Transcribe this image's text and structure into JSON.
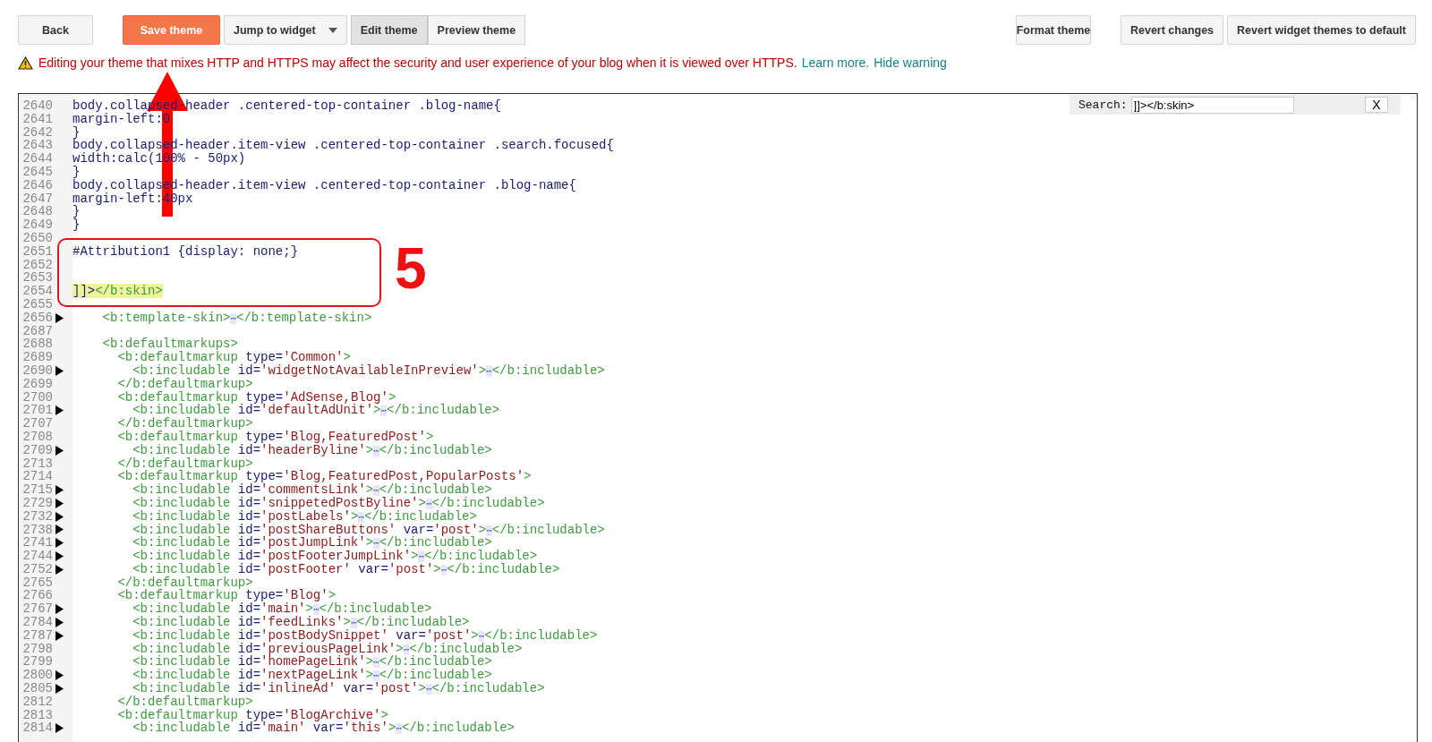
{
  "toolbar": {
    "left_buttons": [
      {
        "label": "Back",
        "kind": "plain"
      },
      {
        "label": "Save theme",
        "kind": "primary"
      },
      {
        "label": "Jump to widget",
        "kind": "dropdown"
      }
    ],
    "tabs": [
      {
        "label": "Edit theme",
        "selected": true
      },
      {
        "label": "Preview theme",
        "selected": false
      }
    ],
    "right_buttons": [
      {
        "label": "Format theme",
        "kind": "plain"
      },
      {
        "label": "Revert changes",
        "kind": "plain"
      },
      {
        "label": "Revert widget themes to default",
        "kind": "plain"
      }
    ]
  },
  "warning": {
    "text": "Editing your theme that mixes HTTP and HTTPS may affect the security and user experience of your blog when it is viewed over HTTPS.",
    "links": [
      "Learn more.",
      "Hide warning"
    ]
  },
  "editor": {
    "search": {
      "label": "Search:",
      "value": "]]></b:skin>",
      "close": "X"
    },
    "lines": [
      {
        "n": "2640",
        "fold": false,
        "t": [
          {
            "kind": "css",
            "text": "body.collapsed-header .centered-top-container .blog-name{"
          }
        ]
      },
      {
        "n": "2641",
        "fold": false,
        "t": [
          {
            "kind": "css",
            "text": "margin-left:0"
          }
        ]
      },
      {
        "n": "2642",
        "fold": false,
        "t": [
          {
            "kind": "css",
            "text": "}"
          }
        ]
      },
      {
        "n": "2643",
        "fold": false,
        "t": [
          {
            "kind": "css",
            "text": "body.collapsed-header.item-view .centered-top-container .search.focused{"
          }
        ]
      },
      {
        "n": "2644",
        "fold": false,
        "t": [
          {
            "kind": "css",
            "text": "width:calc(100% - 50px)"
          }
        ]
      },
      {
        "n": "2645",
        "fold": false,
        "t": [
          {
            "kind": "css",
            "text": "}"
          }
        ]
      },
      {
        "n": "2646",
        "fold": false,
        "t": [
          {
            "kind": "css",
            "text": "body.collapsed-header.item-view .centered-top-container .blog-name{"
          }
        ]
      },
      {
        "n": "2647",
        "fold": false,
        "t": [
          {
            "kind": "css",
            "text": "margin-left:40px"
          }
        ]
      },
      {
        "n": "2648",
        "fold": false,
        "t": [
          {
            "kind": "css",
            "text": "}"
          }
        ]
      },
      {
        "n": "2649",
        "fold": false,
        "t": [
          {
            "kind": "css",
            "text": "}"
          }
        ]
      },
      {
        "n": "2650",
        "fold": false
      },
      {
        "n": "2651",
        "fold": false,
        "t": [
          {
            "kind": "css",
            "text": "#Attribution1 {display: none;}"
          }
        ]
      },
      {
        "n": "2652",
        "fold": false
      },
      {
        "n": "2653",
        "fold": false
      },
      {
        "n": "2654",
        "fold": false,
        "t": [
          {
            "kind": "match-css",
            "text": "]]>"
          },
          {
            "kind": "match-tag",
            "text": "</b:skin>"
          }
        ]
      },
      {
        "n": "2655",
        "fold": false
      },
      {
        "n": "2656",
        "fold": true,
        "t": [
          {
            "kind": "tag",
            "text": "    <b:template-skin>"
          },
          {
            "kind": "ellipsis",
            "text": "⋯"
          },
          {
            "kind": "tag",
            "text": "</b:template-skin>"
          }
        ]
      },
      {
        "n": "2687",
        "fold": false
      },
      {
        "n": "2688",
        "fold": false,
        "t": [
          {
            "kind": "tag",
            "text": "    <b:defaultmarkups>"
          }
        ]
      },
      {
        "n": "2689",
        "fold": false,
        "t": [
          {
            "kind": "tag",
            "text": "      <b:defaultmarkup"
          },
          {
            "kind": "attr",
            "text": " type="
          },
          {
            "kind": "value",
            "text": "'Common'"
          },
          {
            "kind": "tag",
            "text": ">"
          }
        ]
      },
      {
        "n": "2690",
        "fold": true,
        "t": [
          {
            "kind": "tag",
            "text": "        <b:includable"
          },
          {
            "kind": "attr",
            "text": " id="
          },
          {
            "kind": "value",
            "text": "'widgetNotAvailableInPreview'"
          },
          {
            "kind": "tag",
            "text": ">"
          },
          {
            "kind": "ellipsis",
            "text": "⋯"
          },
          {
            "kind": "tag",
            "text": "</b:includable>"
          }
        ]
      },
      {
        "n": "2699",
        "fold": false,
        "t": [
          {
            "kind": "tag",
            "text": "      </b:defaultmarkup>"
          }
        ]
      },
      {
        "n": "2700",
        "fold": false,
        "t": [
          {
            "kind": "tag",
            "text": "      <b:defaultmarkup"
          },
          {
            "kind": "attr",
            "text": " type="
          },
          {
            "kind": "value",
            "text": "'AdSense,Blog'"
          },
          {
            "kind": "tag",
            "text": ">"
          }
        ]
      },
      {
        "n": "2701",
        "fold": true,
        "t": [
          {
            "kind": "tag",
            "text": "        <b:includable"
          },
          {
            "kind": "attr",
            "text": " id="
          },
          {
            "kind": "value",
            "text": "'defaultAdUnit'"
          },
          {
            "kind": "tag",
            "text": ">"
          },
          {
            "kind": "ellipsis",
            "text": "⋯"
          },
          {
            "kind": "tag",
            "text": "</b:includable>"
          }
        ]
      },
      {
        "n": "2707",
        "fold": false,
        "t": [
          {
            "kind": "tag",
            "text": "      </b:defaultmarkup>"
          }
        ]
      },
      {
        "n": "2708",
        "fold": false,
        "t": [
          {
            "kind": "tag",
            "text": "      <b:defaultmarkup"
          },
          {
            "kind": "attr",
            "text": " type="
          },
          {
            "kind": "value",
            "text": "'Blog,FeaturedPost'"
          },
          {
            "kind": "tag",
            "text": ">"
          }
        ]
      },
      {
        "n": "2709",
        "fold": true,
        "t": [
          {
            "kind": "tag",
            "text": "        <b:includable"
          },
          {
            "kind": "attr",
            "text": " id="
          },
          {
            "kind": "value",
            "text": "'headerByline'"
          },
          {
            "kind": "tag",
            "text": ">"
          },
          {
            "kind": "ellipsis",
            "text": "⋯"
          },
          {
            "kind": "tag",
            "text": "</b:includable>"
          }
        ]
      },
      {
        "n": "2713",
        "fold": false,
        "t": [
          {
            "kind": "tag",
            "text": "      </b:defaultmarkup>"
          }
        ]
      },
      {
        "n": "2714",
        "fold": false,
        "t": [
          {
            "kind": "tag",
            "text": "      <b:defaultmarkup"
          },
          {
            "kind": "attr",
            "text": " type="
          },
          {
            "kind": "value",
            "text": "'Blog,FeaturedPost,PopularPosts'"
          },
          {
            "kind": "tag",
            "text": ">"
          }
        ]
      },
      {
        "n": "2715",
        "fold": true,
        "t": [
          {
            "kind": "tag",
            "text": "        <b:includable"
          },
          {
            "kind": "attr",
            "text": " id="
          },
          {
            "kind": "value",
            "text": "'commentsLink'"
          },
          {
            "kind": "tag",
            "text": ">"
          },
          {
            "kind": "ellipsis",
            "text": "⋯"
          },
          {
            "kind": "tag",
            "text": "</b:includable>"
          }
        ]
      },
      {
        "n": "2729",
        "fold": true,
        "t": [
          {
            "kind": "tag",
            "text": "        <b:includable"
          },
          {
            "kind": "attr",
            "text": " id="
          },
          {
            "kind": "value",
            "text": "'snippetedPostByline'"
          },
          {
            "kind": "tag",
            "text": ">"
          },
          {
            "kind": "ellipsis",
            "text": "⋯"
          },
          {
            "kind": "tag",
            "text": "</b:includable>"
          }
        ]
      },
      {
        "n": "2732",
        "fold": true,
        "t": [
          {
            "kind": "tag",
            "text": "        <b:includable"
          },
          {
            "kind": "attr",
            "text": " id="
          },
          {
            "kind": "value",
            "text": "'postLabels'"
          },
          {
            "kind": "tag",
            "text": ">"
          },
          {
            "kind": "ellipsis",
            "text": "⋯"
          },
          {
            "kind": "tag",
            "text": "</b:includable>"
          }
        ]
      },
      {
        "n": "2738",
        "fold": true,
        "t": [
          {
            "kind": "tag",
            "text": "        <b:includable"
          },
          {
            "kind": "attr",
            "text": " id="
          },
          {
            "kind": "value",
            "text": "'postShareButtons'"
          },
          {
            "kind": "attr",
            "text": " var="
          },
          {
            "kind": "value",
            "text": "'post'"
          },
          {
            "kind": "tag",
            "text": ">"
          },
          {
            "kind": "ellipsis",
            "text": "⋯"
          },
          {
            "kind": "tag",
            "text": "</b:includable>"
          }
        ]
      },
      {
        "n": "2741",
        "fold": true,
        "t": [
          {
            "kind": "tag",
            "text": "        <b:includable"
          },
          {
            "kind": "attr",
            "text": " id="
          },
          {
            "kind": "value",
            "text": "'postJumpLink'"
          },
          {
            "kind": "tag",
            "text": ">"
          },
          {
            "kind": "ellipsis",
            "text": "⋯"
          },
          {
            "kind": "tag",
            "text": "</b:includable>"
          }
        ]
      },
      {
        "n": "2744",
        "fold": true,
        "t": [
          {
            "kind": "tag",
            "text": "        <b:includable"
          },
          {
            "kind": "attr",
            "text": " id="
          },
          {
            "kind": "value",
            "text": "'postFooterJumpLink'"
          },
          {
            "kind": "tag",
            "text": ">"
          },
          {
            "kind": "ellipsis",
            "text": "⋯"
          },
          {
            "kind": "tag",
            "text": "</b:includable>"
          }
        ]
      },
      {
        "n": "2752",
        "fold": true,
        "t": [
          {
            "kind": "tag",
            "text": "        <b:includable"
          },
          {
            "kind": "attr",
            "text": " id="
          },
          {
            "kind": "value",
            "text": "'postFooter'"
          },
          {
            "kind": "attr",
            "text": " var="
          },
          {
            "kind": "value",
            "text": "'post'"
          },
          {
            "kind": "tag",
            "text": ">"
          },
          {
            "kind": "ellipsis",
            "text": "⋯"
          },
          {
            "kind": "tag",
            "text": "</b:includable>"
          }
        ]
      },
      {
        "n": "2765",
        "fold": false,
        "t": [
          {
            "kind": "tag",
            "text": "      </b:defaultmarkup>"
          }
        ]
      },
      {
        "n": "2766",
        "fold": false,
        "t": [
          {
            "kind": "tag",
            "text": "      <b:defaultmarkup"
          },
          {
            "kind": "attr",
            "text": " type="
          },
          {
            "kind": "value",
            "text": "'Blog'"
          },
          {
            "kind": "tag",
            "text": ">"
          }
        ]
      },
      {
        "n": "2767",
        "fold": true,
        "t": [
          {
            "kind": "tag",
            "text": "        <b:includable"
          },
          {
            "kind": "attr",
            "text": " id="
          },
          {
            "kind": "value",
            "text": "'main'"
          },
          {
            "kind": "tag",
            "text": ">"
          },
          {
            "kind": "ellipsis",
            "text": "⋯"
          },
          {
            "kind": "tag",
            "text": "</b:includable>"
          }
        ]
      },
      {
        "n": "2784",
        "fold": true,
        "t": [
          {
            "kind": "tag",
            "text": "        <b:includable"
          },
          {
            "kind": "attr",
            "text": " id="
          },
          {
            "kind": "value",
            "text": "'feedLinks'"
          },
          {
            "kind": "tag",
            "text": ">"
          },
          {
            "kind": "ellipsis",
            "text": "⋯"
          },
          {
            "kind": "tag",
            "text": "</b:includable>"
          }
        ]
      },
      {
        "n": "2787",
        "fold": true,
        "t": [
          {
            "kind": "tag",
            "text": "        <b:includable"
          },
          {
            "kind": "attr",
            "text": " id="
          },
          {
            "kind": "value",
            "text": "'postBodySnippet'"
          },
          {
            "kind": "attr",
            "text": " var="
          },
          {
            "kind": "value",
            "text": "'post'"
          },
          {
            "kind": "tag",
            "text": ">"
          },
          {
            "kind": "ellipsis",
            "text": "⋯"
          },
          {
            "kind": "tag",
            "text": "</b:includable>"
          }
        ]
      },
      {
        "n": "2798",
        "fold": false,
        "t": [
          {
            "kind": "tag",
            "text": "        <b:includable"
          },
          {
            "kind": "attr",
            "text": " id="
          },
          {
            "kind": "value",
            "text": "'previousPageLink'"
          },
          {
            "kind": "tag",
            "text": ">"
          },
          {
            "kind": "ellipsis",
            "text": "⋯"
          },
          {
            "kind": "tag",
            "text": "</b:includable>"
          }
        ]
      },
      {
        "n": "2799",
        "fold": false,
        "t": [
          {
            "kind": "tag",
            "text": "        <b:includable"
          },
          {
            "kind": "attr",
            "text": " id="
          },
          {
            "kind": "value",
            "text": "'homePageLink'"
          },
          {
            "kind": "tag",
            "text": ">"
          },
          {
            "kind": "ellipsis",
            "text": "⋯"
          },
          {
            "kind": "tag",
            "text": "</b:includable>"
          }
        ]
      },
      {
        "n": "2800",
        "fold": true,
        "t": [
          {
            "kind": "tag",
            "text": "        <b:includable"
          },
          {
            "kind": "attr",
            "text": " id="
          },
          {
            "kind": "value",
            "text": "'nextPageLink'"
          },
          {
            "kind": "tag",
            "text": ">"
          },
          {
            "kind": "ellipsis",
            "text": "⋯"
          },
          {
            "kind": "tag",
            "text": "</b:includable>"
          }
        ]
      },
      {
        "n": "2805",
        "fold": true,
        "t": [
          {
            "kind": "tag",
            "text": "        <b:includable"
          },
          {
            "kind": "attr",
            "text": " id="
          },
          {
            "kind": "value",
            "text": "'inlineAd'"
          },
          {
            "kind": "attr",
            "text": " var="
          },
          {
            "kind": "value",
            "text": "'post'"
          },
          {
            "kind": "tag",
            "text": ">"
          },
          {
            "kind": "ellipsis",
            "text": "⋯"
          },
          {
            "kind": "tag",
            "text": "</b:includable>"
          }
        ]
      },
      {
        "n": "2812",
        "fold": false,
        "t": [
          {
            "kind": "tag",
            "text": "      </b:defaultmarkup>"
          }
        ]
      },
      {
        "n": "2813",
        "fold": false,
        "t": [
          {
            "kind": "tag",
            "text": "      <b:defaultmarkup"
          },
          {
            "kind": "attr",
            "text": " type="
          },
          {
            "kind": "value",
            "text": "'BlogArchive'"
          },
          {
            "kind": "tag",
            "text": ">"
          }
        ]
      },
      {
        "n": "2814",
        "fold": true,
        "t": [
          {
            "kind": "tag",
            "text": "        <b:includable"
          },
          {
            "kind": "attr",
            "text": " id="
          },
          {
            "kind": "value",
            "text": "'main'"
          },
          {
            "kind": "attr",
            "text": " var="
          },
          {
            "kind": "value",
            "text": "'this'"
          },
          {
            "kind": "tag",
            "text": ">"
          },
          {
            "kind": "ellipsis",
            "text": "⋯"
          },
          {
            "kind": "tag",
            "text": "</b:includable>"
          }
        ]
      }
    ]
  },
  "annotation": {
    "number": "5"
  }
}
